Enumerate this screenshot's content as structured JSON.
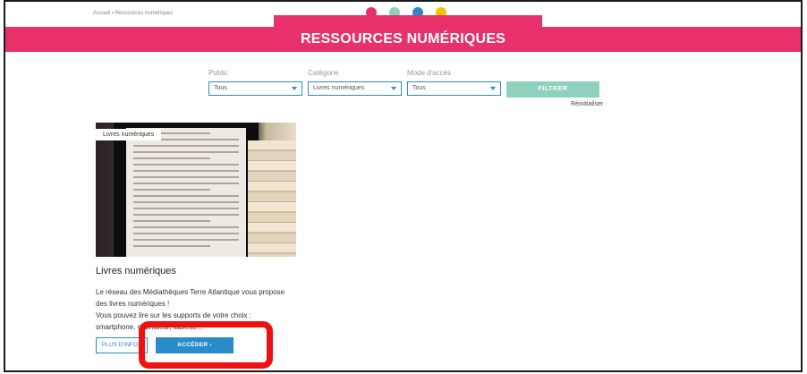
{
  "breadcrumb": {
    "home": "Accueil",
    "separator": "»",
    "current": "Ressources numériques"
  },
  "banner": {
    "title": "RESSOURCES NUMÉRIQUES",
    "dots": [
      "#e8306a",
      "#8ed1bd",
      "#2b8bc9",
      "#f5c400"
    ]
  },
  "filters": {
    "public": {
      "label": "Public",
      "value": "Tous"
    },
    "category": {
      "label": "Catégorie",
      "value": "Livres numériques"
    },
    "access": {
      "label": "Mode d'accès",
      "value": "Tous"
    },
    "submit_label": "FILTRER",
    "reset_label": "Réinitialiser"
  },
  "card": {
    "tag": "Livres numériques",
    "title": "Livres numériques",
    "description_line1": "Le réseau des Médiathèques Terre Atlantique vous propose des livres numériques !",
    "description_line2": "Vous pouvez lire sur les supports de votre choix : smartphone, ordinateur, tablette...",
    "more_label": "PLUS D'INFOS",
    "access_label": "ACCÉDER ›"
  },
  "colors": {
    "brand_pink": "#e8306a",
    "brand_blue": "#2b8bc9",
    "brand_mint": "#8ed1bd",
    "highlight": "#ee1111"
  }
}
